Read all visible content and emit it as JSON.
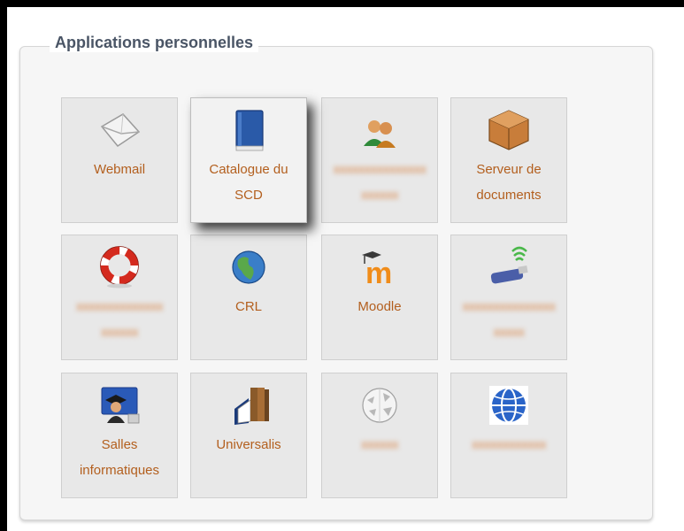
{
  "section": {
    "title": "Applications personnelles"
  },
  "tiles": [
    {
      "name": "webmail",
      "label": "Webmail",
      "icon": "envelope-icon"
    },
    {
      "name": "catalogue",
      "label_line1": "Catalogue du",
      "label_line2": "SCD",
      "icon": "book-icon"
    },
    {
      "name": "users",
      "label": "",
      "icon": "users-icon"
    },
    {
      "name": "serveur",
      "label_line1": "Serveur de",
      "label_line2": "documents",
      "icon": "crate-icon"
    },
    {
      "name": "assistance",
      "label": "",
      "icon": "lifebuoy-icon"
    },
    {
      "name": "crl",
      "label": "CRL",
      "icon": "globe-icon"
    },
    {
      "name": "moodle",
      "label": "Moodle",
      "icon": "moodle-icon"
    },
    {
      "name": "wifi",
      "label": "",
      "icon": "wifi-usb-icon"
    },
    {
      "name": "salles",
      "label_line1": "Salles",
      "label_line2": "informatiques",
      "icon": "graduate-icon"
    },
    {
      "name": "universalis",
      "label": "Universalis",
      "icon": "books-icon"
    },
    {
      "name": "wikipedia",
      "label": "",
      "icon": "wikipedia-icon"
    },
    {
      "name": "web",
      "label": "",
      "icon": "web-globe-icon"
    }
  ],
  "colors": {
    "link": "#b35f1e",
    "legend": "#4a5566",
    "tile_bg": "#e8e8e8"
  }
}
